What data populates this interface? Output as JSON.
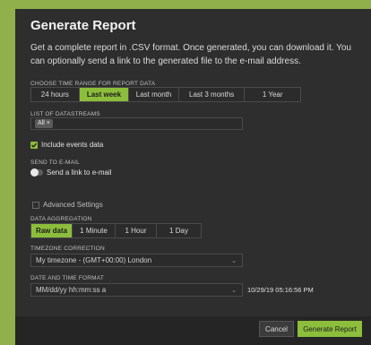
{
  "dialog": {
    "title": "Generate Report",
    "description": "Get a complete report in .CSV format. Once generated, you can download it. You can optionally send a link to the generated file to the e-mail address."
  },
  "time_range": {
    "label": "CHOOSE TIME RANGE FOR REPORT DATA",
    "options": [
      "24 hours",
      "Last week",
      "Last month",
      "Last 3 months",
      "1 Year"
    ],
    "selected": "Last week"
  },
  "datastreams": {
    "label": "LIST OF DATASTREAMS",
    "chip": "All",
    "chip_close": "×"
  },
  "events": {
    "label": "Include events data",
    "checked": true
  },
  "email": {
    "section_label": "SEND TO E-MAIL",
    "toggle_label": "Send a link to e-mail",
    "enabled": false
  },
  "advanced": {
    "label": "Advanced Settings",
    "checked": false
  },
  "aggregation": {
    "label": "DATA AGGREGATION",
    "options": [
      "Raw data",
      "1 Minute",
      "1 Hour",
      "1 Day"
    ],
    "selected": "Raw data"
  },
  "timezone": {
    "label": "TIMEZONE CORRECTION",
    "value": "My timezone - (GMT+00:00) London"
  },
  "datetime": {
    "label": "DATE AND TIME FORMAT",
    "value": "MM/dd/yy hh:mm:ss a",
    "preview": "10/29/19 05:16:56 PM"
  },
  "footer": {
    "cancel_label": "Cancel",
    "generate_label": "Generate Report"
  },
  "colors": {
    "accent": "#8cbe3c",
    "background": "#8fb04a",
    "panel": "#2e2e2e"
  },
  "icons": {
    "chevron": "chevron-down-icon",
    "check": "check-icon",
    "close": "close-icon"
  }
}
